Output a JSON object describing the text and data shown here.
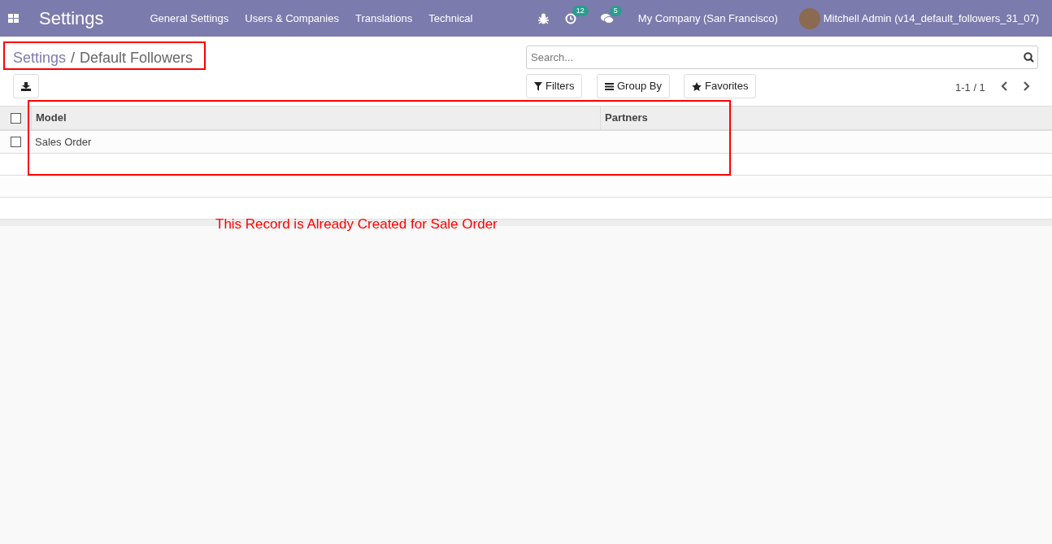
{
  "navbar": {
    "app_title": "Settings",
    "menus": [
      "General Settings",
      "Users & Companies",
      "Translations",
      "Technical"
    ],
    "activity_count": "12",
    "message_count": "5",
    "company": "My Company (San Francisco)",
    "user": "Mitchell Admin (v14_default_followers_31_07)"
  },
  "breadcrumb": [
    "Settings",
    "Default Followers"
  ],
  "breadcrumb_separator": "/",
  "search": {
    "placeholder": "Search..."
  },
  "filter_buttons": [
    "Filters",
    "Group By",
    "Favorites"
  ],
  "pager": "1-1 / 1",
  "table": {
    "columns": [
      "Model",
      "Partners"
    ],
    "all_checked": false,
    "rows": [
      {
        "cells": [
          "Sales Order",
          ""
        ],
        "checked": false
      }
    ]
  },
  "annotation": "This Record is Already Created for Sale Order"
}
